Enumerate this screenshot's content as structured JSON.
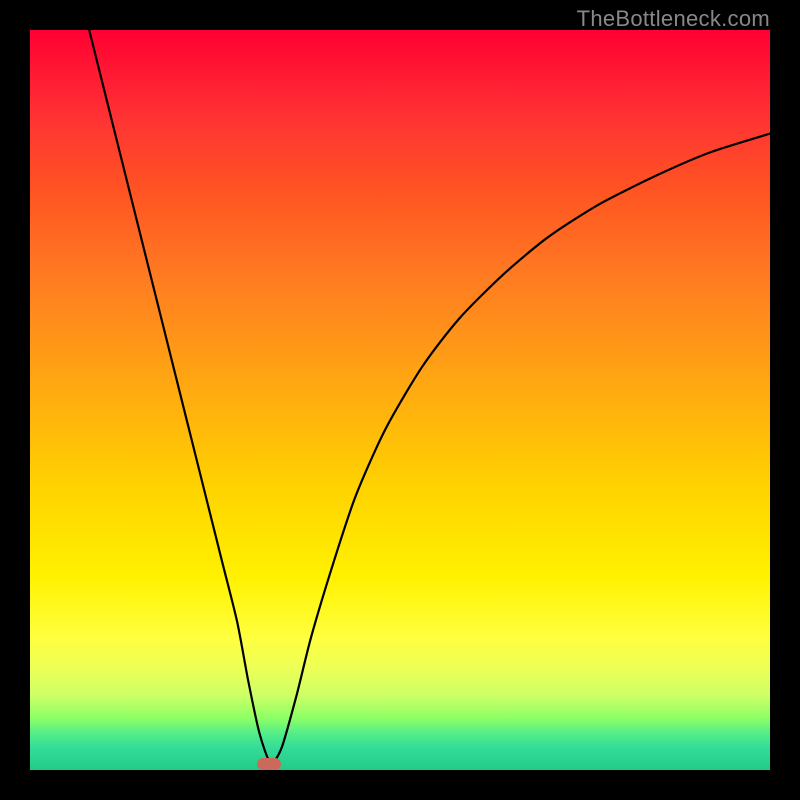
{
  "watermark": "TheBottleneck.com",
  "chart_data": {
    "type": "line",
    "title": "",
    "xlabel": "",
    "ylabel": "",
    "xlim": [
      0,
      100
    ],
    "ylim": [
      0,
      100
    ],
    "series": [
      {
        "name": "curve",
        "x": [
          8,
          10,
          12,
          14,
          16,
          18,
          20,
          22,
          24,
          26,
          28,
          29.5,
          31,
          32.5,
          34,
          36,
          38,
          41,
          44,
          48,
          53,
          58,
          64,
          70,
          77,
          85,
          92,
          100
        ],
        "values": [
          100,
          92,
          84,
          76,
          68,
          60,
          52,
          44,
          36,
          28,
          20,
          12,
          5,
          1,
          3,
          10,
          18,
          28,
          37,
          46,
          54.5,
          61,
          67,
          72,
          76.5,
          80.5,
          83.5,
          86
        ]
      }
    ],
    "marker": {
      "x": 32.3,
      "y": 0.8,
      "color": "#c96a5a"
    },
    "gradient_stops": [
      {
        "pct": 0,
        "color": "#ff0033"
      },
      {
        "pct": 22,
        "color": "#ff5522"
      },
      {
        "pct": 48,
        "color": "#ffa811"
      },
      {
        "pct": 74,
        "color": "#fff200"
      },
      {
        "pct": 90,
        "color": "#ccff66"
      },
      {
        "pct": 100,
        "color": "#22cc88"
      }
    ]
  }
}
